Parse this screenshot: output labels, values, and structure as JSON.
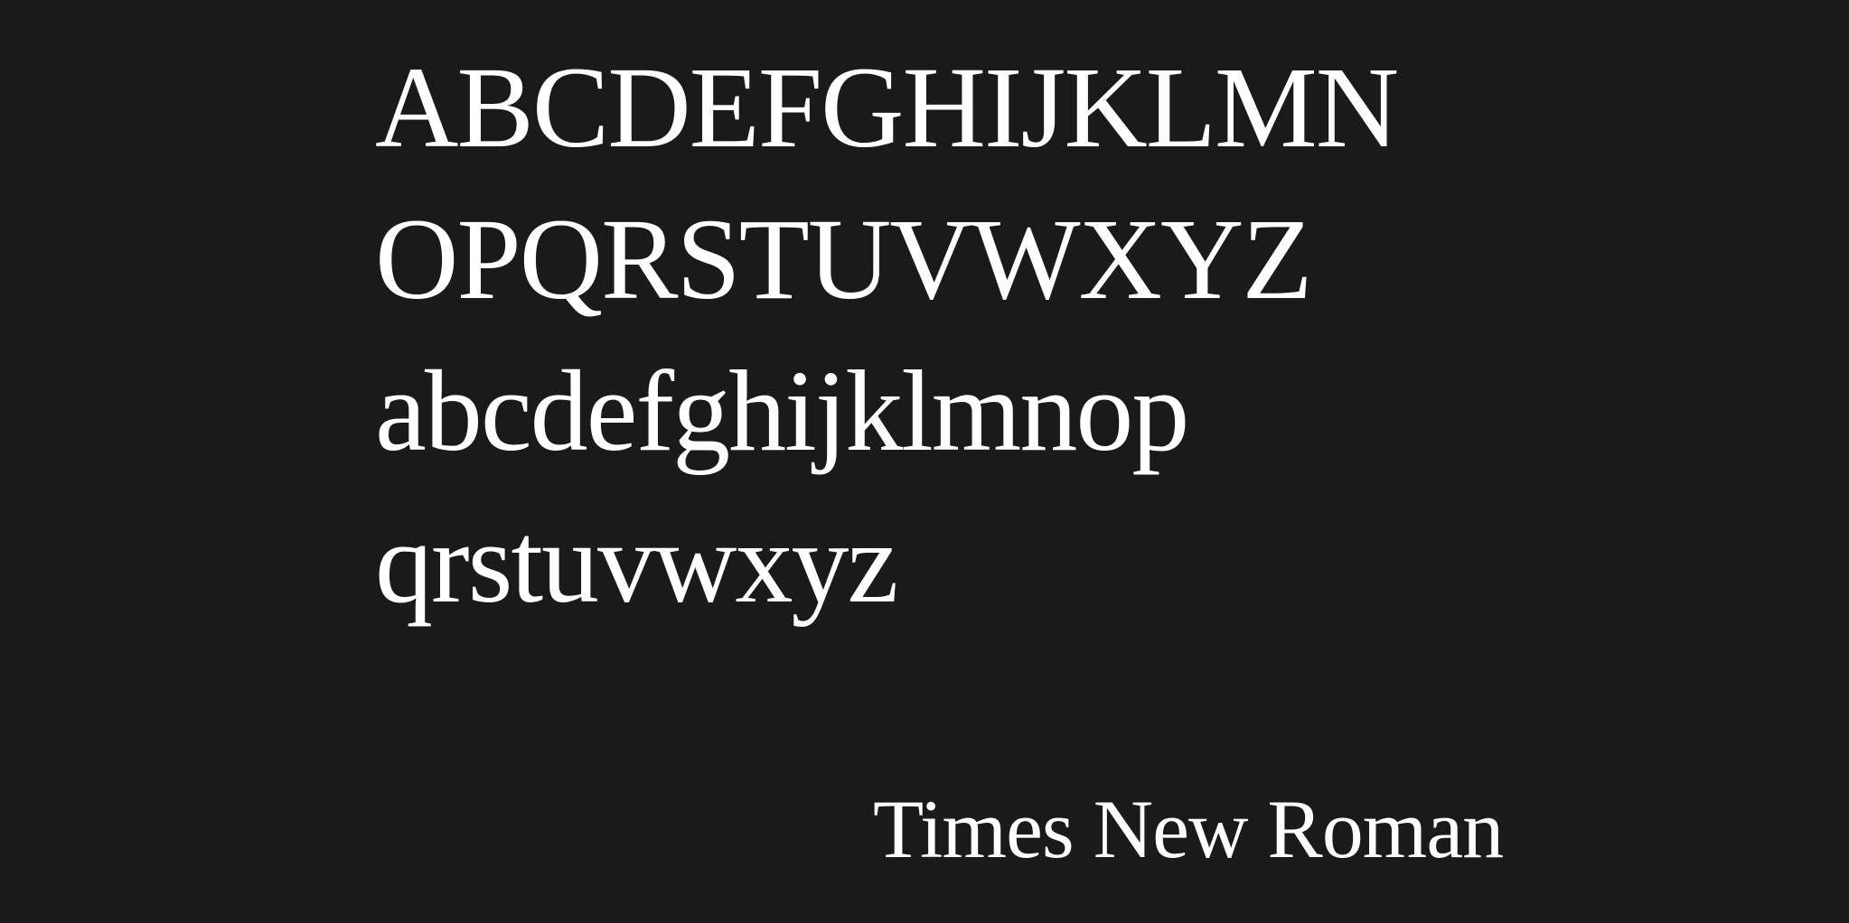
{
  "specimen": {
    "lines": [
      "ABCDEFGHIJKLMN",
      "OPQRSTUVWXYZ",
      "abcdefghijklmnop",
      "qrstuvwxyz"
    ]
  },
  "font_name": "Times New Roman",
  "colors": {
    "background": "#1a1a1a",
    "text": "#ffffff"
  }
}
